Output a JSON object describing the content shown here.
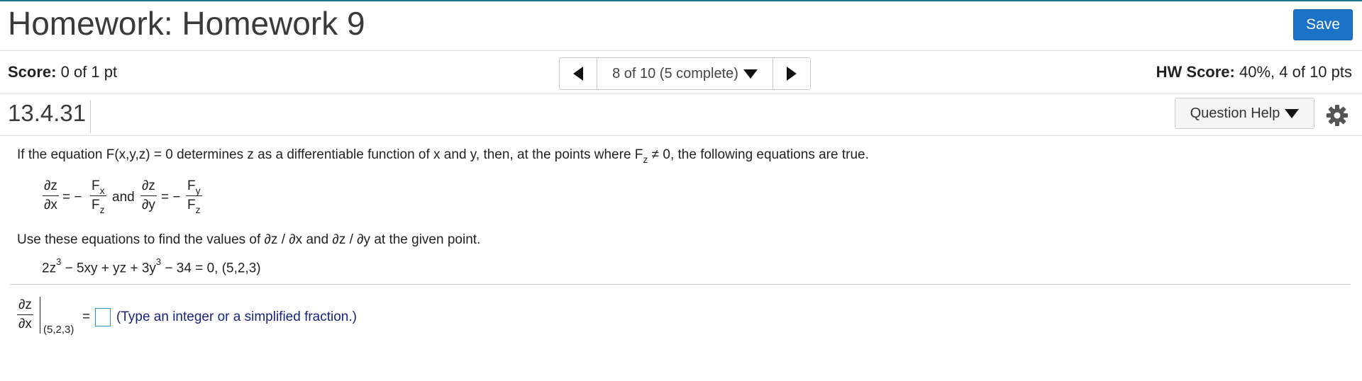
{
  "header": {
    "title": "Homework: Homework 9",
    "save_label": "Save"
  },
  "score_bar": {
    "score_label": "Score:",
    "score_value": "0 of 1 pt",
    "nav_label": "8 of 10 (5 complete)",
    "hw_score_label": "HW Score:",
    "hw_score_value": "40%, 4 of 10 pts"
  },
  "question_bar": {
    "number": "13.4.31",
    "help_label": "Question Help"
  },
  "question": {
    "intro_before": "If the equation F(x,y,z) = 0 determines z as a differentiable function of x and y, then, at the points where F",
    "intro_sub": "z",
    "intro_after": " ≠ 0, the following equations are true.",
    "formula": {
      "dz": "∂z",
      "dx": "∂x",
      "dy": "∂y",
      "eq_minus": "= −",
      "Fx": "F",
      "Fx_sub": "x",
      "Fy": "F",
      "Fy_sub": "y",
      "Fz": "F",
      "Fz_sub": "z",
      "and": "and"
    },
    "instruction": "Use these equations to find the values of ∂z / ∂x and ∂z / ∂y at the given point.",
    "equation": {
      "part1": "2z",
      "exp1": "3",
      "part2": " − 5xy + yz + 3y",
      "exp2": "3",
      "part3": " − 34 = 0, (5,2,3)"
    }
  },
  "answer": {
    "numerator": "∂z",
    "denominator": "∂x",
    "eval_point": "(5,2,3)",
    "equals": "=",
    "hint": "(Type an integer or a simplified fraction.)"
  },
  "icons": {
    "prev": "triangle-left-icon",
    "next": "triangle-right-icon",
    "dropdown": "caret-down-icon",
    "settings": "gear-icon"
  },
  "colors": {
    "accent": "#1a73c6",
    "top_border": "#1a7a8c",
    "hint_text": "#1a237e",
    "input_border": "#2b8fd4"
  }
}
